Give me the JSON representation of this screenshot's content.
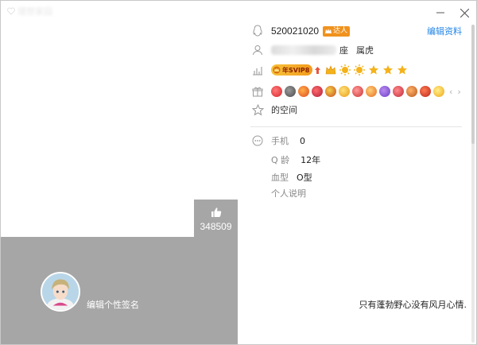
{
  "window": {
    "brand_text": "理想家园"
  },
  "cover": {
    "like_count": "348509",
    "edit_signature": "编辑个性签名"
  },
  "profile": {
    "qq_number": "520021020",
    "vip_tag": "达人",
    "edit_profile": "编辑资料",
    "zodiac": "属虎",
    "constellation_tail": "座",
    "svip_label": "年SVIP8",
    "space_label": "的空间",
    "pager_prev": "‹",
    "pager_next": "›"
  },
  "details": {
    "phone_label": "手机",
    "phone_value": "0",
    "qage_label": "Q 龄",
    "qage_value": "12年",
    "blood_label": "血型",
    "blood_value": "O型",
    "bio_label": "个人说明",
    "bio_text": "只有蓬勃野心没有风月心情."
  },
  "colors": {
    "accent": "#2386e6",
    "cover_gray": "#a6a6a6",
    "vip_orange": "#f0921e",
    "svip_gold": "#f7c23a"
  }
}
